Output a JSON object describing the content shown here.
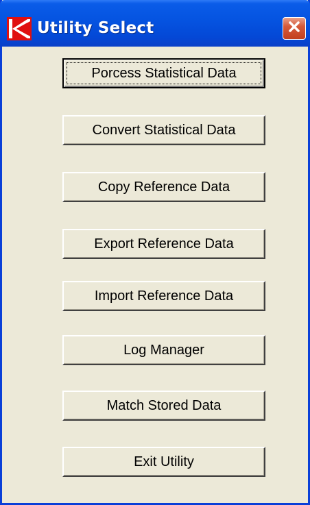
{
  "window": {
    "title": "Utility Select",
    "icon": "app-logo-icon",
    "close_icon": "close-icon",
    "accent_color": "#0553e0",
    "close_color": "#d65a3a"
  },
  "buttons": [
    {
      "label": "Porcess Statistical Data",
      "focused": true
    },
    {
      "label": "Convert Statistical Data",
      "focused": false
    },
    {
      "label": "Copy Reference Data",
      "focused": false
    },
    {
      "label": "Export Reference Data",
      "focused": false
    },
    {
      "label": "Import Reference Data",
      "focused": false
    },
    {
      "label": "Log Manager",
      "focused": false
    },
    {
      "label": "Match Stored Data",
      "focused": false
    },
    {
      "label": "Exit Utility",
      "focused": false
    }
  ]
}
